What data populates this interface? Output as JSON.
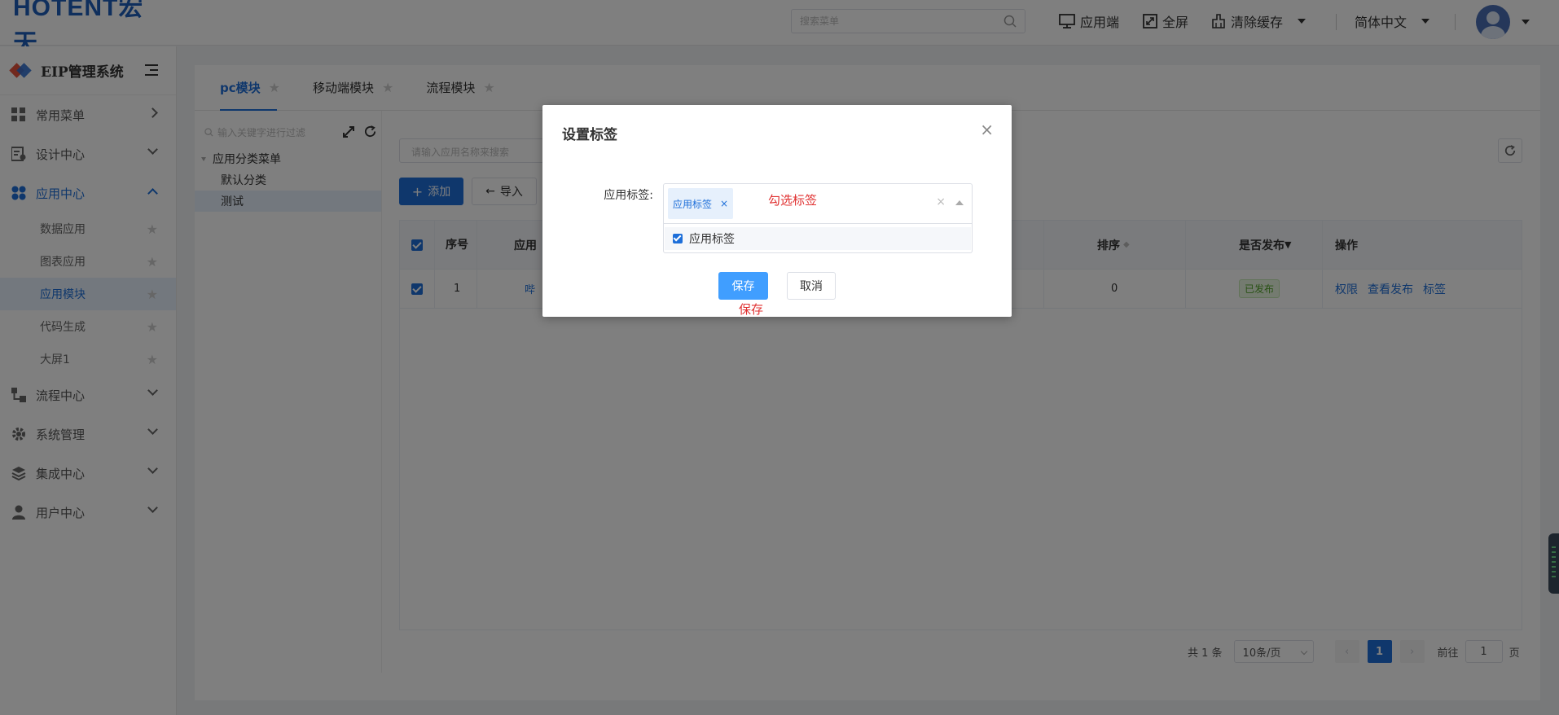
{
  "header": {
    "logo_text": "HOTENT宏天",
    "search_placeholder": "搜索菜单",
    "app_label": "应用端",
    "fullscreen_label": "全屏",
    "clear_cache_label": "清除缓存",
    "language_label": "简体中文"
  },
  "sidebar": {
    "title": "EIP管理系统",
    "items": [
      {
        "label": "常用菜单"
      },
      {
        "label": "设计中心"
      },
      {
        "label": "应用中心"
      },
      {
        "label": "流程中心"
      },
      {
        "label": "系统管理"
      },
      {
        "label": "集成中心"
      },
      {
        "label": "用户中心"
      }
    ],
    "app_sub_items": [
      {
        "label": "数据应用"
      },
      {
        "label": "图表应用"
      },
      {
        "label": "应用模块"
      },
      {
        "label": "代码生成"
      },
      {
        "label": "大屏1"
      }
    ]
  },
  "tabs": [
    {
      "label": "pc模块"
    },
    {
      "label": "移动端模块"
    },
    {
      "label": "流程模块"
    }
  ],
  "tree": {
    "search_placeholder": "输入关键字进行过滤",
    "root": "应用分类菜单",
    "children": [
      "默认分类",
      "测试"
    ]
  },
  "toolbar": {
    "search_placeholder": "请输入应用名称来搜索",
    "add_label": "添加",
    "import_label": "导入"
  },
  "table": {
    "headers": {
      "index": "序号",
      "name": "应用",
      "sort": "排序",
      "published": "是否发布",
      "ops": "操作"
    },
    "rows": [
      {
        "index": "1",
        "name": "哔",
        "sort": "0",
        "published": "已发布",
        "ops": [
          "权限",
          "查看发布",
          "标签"
        ]
      }
    ]
  },
  "pager": {
    "total": "共 1 条",
    "size": "10条/页",
    "current": "1",
    "goto_prefix": "前往",
    "goto_value": "1",
    "goto_suffix": "页"
  },
  "modal": {
    "title": "设置标签",
    "field_label": "应用标签:",
    "selected_tag": "应用标签",
    "hint": "勾选标签",
    "option": "应用标签",
    "save_label": "保存",
    "cancel_label": "取消",
    "save_hint": "保存"
  },
  "colors": {
    "primary": "#1e6fd9",
    "save_button": "#409eff",
    "annotation_red": "#e03131"
  }
}
